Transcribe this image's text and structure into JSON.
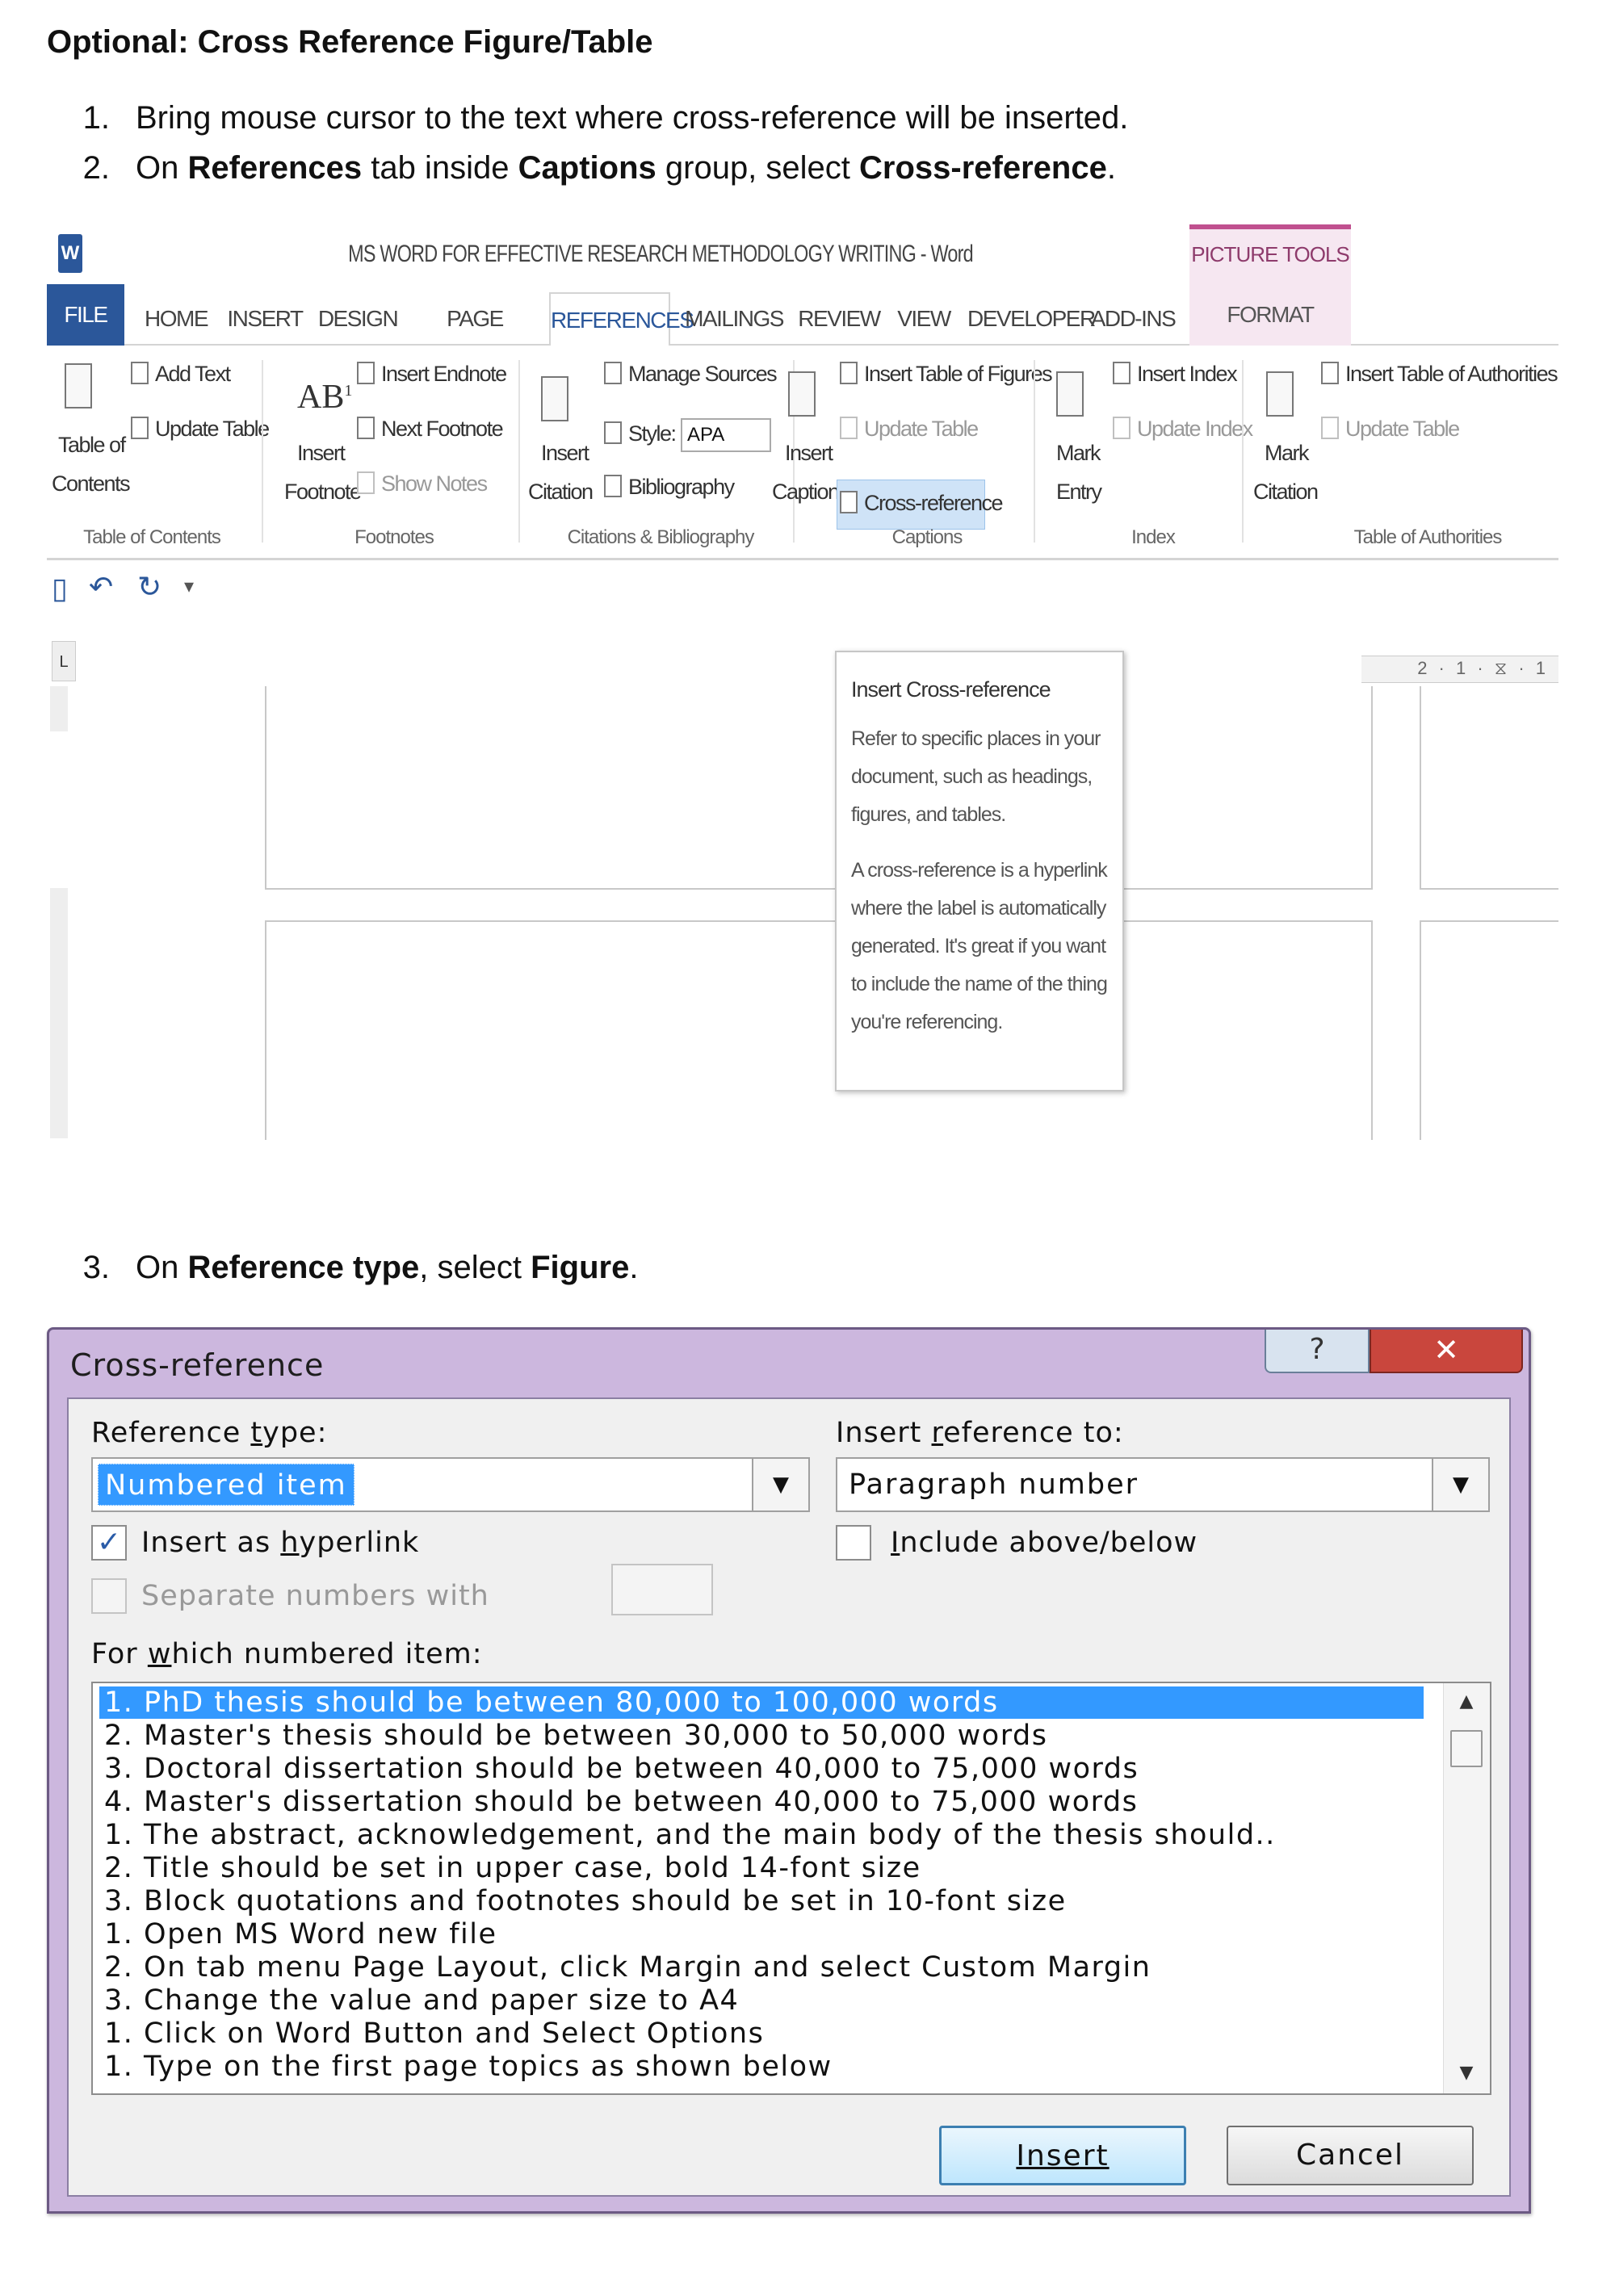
{
  "heading": "Optional: Cross Reference Figure/Table",
  "steps": [
    {
      "num": "1.",
      "pre": "Bring mouse cursor to the text where cross-reference will be inserted.",
      "b1": "",
      "mid": "",
      "b2": "",
      "end": ""
    },
    {
      "num": "2.",
      "pre": "On ",
      "b1": "References",
      "mid": " tab inside ",
      "b2": "Captions",
      "mid2": " group, select ",
      "b3": "Cross-reference",
      "end": "."
    },
    {
      "num": "3.",
      "pre": "On ",
      "b1": "Reference type",
      "mid": ", select ",
      "b2": "Figure",
      "end": "."
    }
  ],
  "word": {
    "title": "MS WORD FOR EFFECTIVE RESEARCH METHODOLOGY WRITING - Word",
    "picture_tools": "PICTURE TOOLS",
    "tabs": [
      "FILE",
      "HOME",
      "INSERT",
      "DESIGN",
      "PAGE LAYOUT",
      "REFERENCES",
      "MAILINGS",
      "REVIEW",
      "VIEW",
      "DEVELOPER",
      "ADD-INS",
      "FORMAT"
    ],
    "ribbon": {
      "toc_big_1": "Table of",
      "toc_big_2": "Contents",
      "add_text": "Add Text",
      "update_table": "Update Table",
      "ins_footnote_1": "Insert",
      "ins_footnote_2": "Footnote",
      "insert_endnote": "Insert Endnote",
      "next_footnote": "Next Footnote",
      "show_notes": "Show Notes",
      "ins_citation_1": "Insert",
      "ins_citation_2": "Citation",
      "manage_sources": "Manage Sources",
      "style_label": "Style:",
      "style_value": "APA",
      "bibliography": "Bibliography",
      "ins_caption_1": "Insert",
      "ins_caption_2": "Caption",
      "insert_tof": "Insert Table of Figures",
      "update_table_cap": "Update Table",
      "cross_reference": "Cross-reference",
      "mark_entry_1": "Mark",
      "mark_entry_2": "Entry",
      "insert_index": "Insert Index",
      "update_index": "Update Index",
      "mark_citation_1": "Mark",
      "mark_citation_2": "Citation",
      "insert_toa": "Insert Table of Authorities",
      "update_table_toa": "Update Table",
      "groups": [
        "Table of Contents",
        "Footnotes",
        "Citations & Bibliography",
        "Captions",
        "Index",
        "Table of Authorities"
      ]
    },
    "ruler_label": "L",
    "ruler_right": "2 · 1 · ⧖ · 1",
    "tooltip": {
      "title": "Insert Cross-reference",
      "p1": "Refer to specific places in your document, such as headings, figures, and tables.",
      "p2": "A cross-reference is a hyperlink where the label is automatically generated. It's great if you want to include the name of the thing you're referencing."
    }
  },
  "dialog": {
    "title": "Cross-reference",
    "help": "?",
    "close": "✕",
    "reference_type_label": "Reference type:",
    "reference_type_value": "Numbered item",
    "insert_ref_label": "Insert reference to:",
    "insert_ref_value": "Paragraph number",
    "insert_hyperlink": "Insert as hyperlink",
    "insert_hyperlink_checked": true,
    "include_above_below": "Include above/below",
    "separate_numbers": "Separate numbers with",
    "for_which_label": "For which numbered item:",
    "items": [
      "1. PhD thesis should be between 80,000 to 100,000 words",
      "2. Master's thesis should be between 30,000 to 50,000 words",
      "3. Doctoral dissertation should be between 40,000 to 75,000 words",
      "4. Master's dissertation should be between 40,000 to 75,000 words",
      "1. The abstract, acknowledgement, and the main body of the thesis should..",
      "2. Title should be set in upper case, bold 14-font size",
      "3. Block quotations and footnotes should be set in 10-font size",
      "1. Open MS Word new file",
      "2. On tab menu Page Layout, click Margin and select Custom Margin",
      "3. Change the value and paper size to A4",
      "1. Click on Word Button and Select Options",
      "1. Type on the first page topics as shown below"
    ],
    "insert_button": "Insert",
    "cancel_button": "Cancel"
  }
}
